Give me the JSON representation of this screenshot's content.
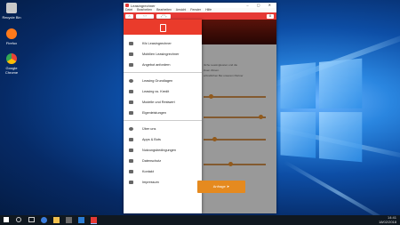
{
  "desktop": {
    "icons": [
      {
        "label": "Recycle Bin",
        "color": "#c9c9c9"
      },
      {
        "label": "Firefox",
        "color": "#ff7a1a"
      },
      {
        "label": "Google Chrome",
        "color": "#3aa757"
      }
    ]
  },
  "window": {
    "title": "Leasingrechner",
    "controls": "– ▢ ✕",
    "menu": [
      "Datei",
      "Bearbeiten",
      "Bearbeiten",
      "Ansicht",
      "Fenster",
      "Hilfe"
    ],
    "accent": "#e53935"
  },
  "drawer": {
    "header_color": "#ea3b2b",
    "items": [
      {
        "label": "Kfz Leasingrechner",
        "icon": "car-icon"
      },
      {
        "label": "Mobilien Leasingrechner",
        "icon": "truck-icon"
      },
      {
        "label": "Angebot anfordern",
        "icon": "cart-icon"
      },
      {
        "label": "Leasing Grundlagen",
        "icon": "clock-icon"
      },
      {
        "label": "Leasing vs. Kredit",
        "icon": "trend-icon"
      },
      {
        "label": "Modelle und Restwert",
        "icon": "list-icon"
      },
      {
        "label": "Eigenleistungen",
        "icon": "card-icon"
      },
      {
        "label": "Über uns",
        "icon": "info-icon"
      },
      {
        "label": "Apps & Bots",
        "icon": "apps-icon"
      },
      {
        "label": "Nutzungsbedingungen",
        "icon": "document-icon"
      },
      {
        "label": "Datenschutz",
        "icon": "lock-icon"
      },
      {
        "label": "Kontakt",
        "icon": "mail-icon"
      },
      {
        "label": "Impressum",
        "icon": "building-icon"
      }
    ]
  },
  "content": {
    "text_lines": [
      "rliche Leasingkosten und die",
      "lösen Zinsen.",
      "erbindlichen Bei unserem Partner"
    ],
    "button_label": "Anfrage"
  },
  "taskbar": {
    "time": "14:41",
    "date": "18/02/2018"
  }
}
